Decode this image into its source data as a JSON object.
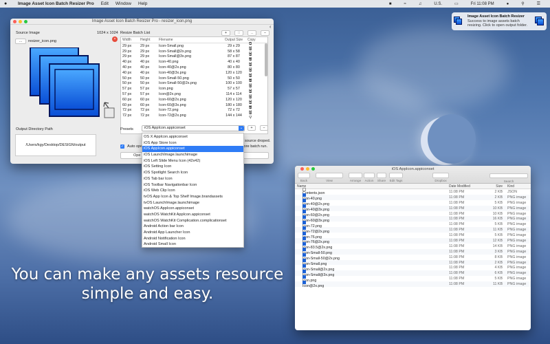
{
  "menubar": {
    "app_name": "Image Asset Icon Batch Resizer Pro",
    "items": [
      "Edit",
      "Window",
      "Help"
    ],
    "locale": "U.S.",
    "clock": "Fri 11:08 PM"
  },
  "notification": {
    "title": "Image Asset Icon Batch Resizer",
    "line1": "Success to image assets batch",
    "line2": "resizing. Click to open output folder."
  },
  "window": {
    "title": "Image Asset Icon Batch Resizer Pro - resizer_icon.png",
    "source_label": "Source Image",
    "source_size": "1024 x 1024",
    "source_button": "...",
    "source_file": "resizer_icon.png",
    "resize_label": "Resize Batch List",
    "toolbar_buttons": [
      "+",
      "::",
      "..",
      "−"
    ],
    "columns": [
      "Width",
      "Height",
      "Filename",
      "Output Size",
      "Copy"
    ],
    "rows": [
      [
        "29 px",
        "29 px",
        "Icon-Small.png",
        "29 x 29"
      ],
      [
        "29 px",
        "29 px",
        "Icon-Small@2x.png",
        "58 x 58"
      ],
      [
        "29 px",
        "29 px",
        "Icon-Small@3x.png",
        "87 x 87"
      ],
      [
        "40 px",
        "40 px",
        "Icon-40.png",
        "40 x 40"
      ],
      [
        "40 px",
        "40 px",
        "Icon-40@2x.png",
        "80 x 80"
      ],
      [
        "40 px",
        "40 px",
        "Icon-40@3x.png",
        "120 x 120"
      ],
      [
        "50 px",
        "50 px",
        "Icon-Small-50.png",
        "50 x 50"
      ],
      [
        "50 px",
        "50 px",
        "Icon-Small-50@2x.png",
        "100 x 100"
      ],
      [
        "57 px",
        "57 px",
        "Icon.png",
        "57 x 57"
      ],
      [
        "57 px",
        "57 px",
        "Icon@2x.png",
        "114 x 114"
      ],
      [
        "60 px",
        "60 px",
        "Icon-60@2x.png",
        "120 x 120"
      ],
      [
        "60 px",
        "60 px",
        "Icon-60@3x.png",
        "180 x 180"
      ],
      [
        "72 px",
        "72 px",
        "Icon-72.png",
        "72 x 72"
      ],
      [
        "72 px",
        "72 px",
        "Icon-72@2x.png",
        "144 x 144"
      ]
    ],
    "output_label": "Output Directory Path",
    "output_path": "/Users/kgy/Desktop/DESIGN/output",
    "presets_label": "Presets",
    "preset_value": "iOS AppIcon.appiconset",
    "preset_plus": "+",
    "preset_minus": "−",
    "auto_open_label": "Auto ope",
    "hidden_text_1": "source droped.",
    "hidden_text_2": "fore batch run.",
    "open_button": "Ope"
  },
  "dropdown": {
    "options": [
      "OS X AppIcon.appiconset",
      "iOS App Store Icon",
      "iOS AppIcon.appiconset",
      "iOS LaunchImage.launchimage",
      "iOS Left Slide Menu Icon (42x42)",
      "iOS Setting Icon",
      "iOS Spotlight Search Icon",
      "iOS Tab bar Icon",
      "iOS Toolbar Navigationbar Icon",
      "iOS Web Clip Icon",
      "tvOS App Icon & Top Shelf Image.brandassets",
      "tvOS LaunchImage.launchimage",
      "watchOS AppIcon.appiconset",
      "watchOS WatchKit AppIcon.appiconset",
      "watchOS WatchKit Complication.complicationset",
      "Android Action bar Icon",
      "Android App Launcher Icon",
      "Android Notification Icon",
      "Android Small Icon"
    ],
    "selected_index": 2
  },
  "finder": {
    "title": "iOS AppIcon.appiconset",
    "toolbar": [
      "Back",
      "View",
      "Arrange",
      "Action",
      "Share",
      "Edit Tags",
      "Dropbox",
      "Search"
    ],
    "columns": [
      "Name",
      "Date Modified",
      "Size",
      "Kind"
    ],
    "files": [
      [
        "Contents.json",
        "11:08 PM",
        "2 KB",
        "JSON"
      ],
      [
        "Icon-40.png",
        "11:08 PM",
        "2 KB",
        "PNG image"
      ],
      [
        "Icon-40@2x.png",
        "11:08 PM",
        "5 KB",
        "PNG image"
      ],
      [
        "Icon-40@3x.png",
        "11:08 PM",
        "10 KB",
        "PNG image"
      ],
      [
        "Icon-60@2x.png",
        "11:08 PM",
        "10 KB",
        "PNG image"
      ],
      [
        "Icon-60@3x.png",
        "11:08 PM",
        "16 KB",
        "PNG image"
      ],
      [
        "Icon-72.png",
        "11:08 PM",
        "5 KB",
        "PNG image"
      ],
      [
        "Icon-72@2x.png",
        "11:08 PM",
        "11 KB",
        "PNG image"
      ],
      [
        "Icon-76.png",
        "11:08 PM",
        "5 KB",
        "PNG image"
      ],
      [
        "Icon-76@2x.png",
        "11:08 PM",
        "12 KB",
        "PNG image"
      ],
      [
        "Icon-83.5@2x.png",
        "11:08 PM",
        "14 KB",
        "PNG image"
      ],
      [
        "Icon-Small-50.png",
        "11:08 PM",
        "3 KB",
        "PNG image"
      ],
      [
        "Icon-Small-50@2x.png",
        "11:08 PM",
        "8 KB",
        "PNG image"
      ],
      [
        "Icon-Small.png",
        "11:08 PM",
        "2 KB",
        "PNG image"
      ],
      [
        "Icon-Small@2x.png",
        "11:08 PM",
        "4 KB",
        "PNG image"
      ],
      [
        "Icon-Small@3x.png",
        "11:08 PM",
        "6 KB",
        "PNG image"
      ],
      [
        "Icon.png",
        "11:08 PM",
        "5 KB",
        "PNG image"
      ],
      [
        "Icon@2x.png",
        "11:08 PM",
        "11 KB",
        "PNG image"
      ]
    ]
  },
  "tagline": {
    "line1": "You can make any assets resource",
    "line2": "simple and easy."
  },
  "colors": {
    "accent": "#2f7cf6",
    "icon_blue": "#1c62d6",
    "icon_outline": "#02145c"
  }
}
